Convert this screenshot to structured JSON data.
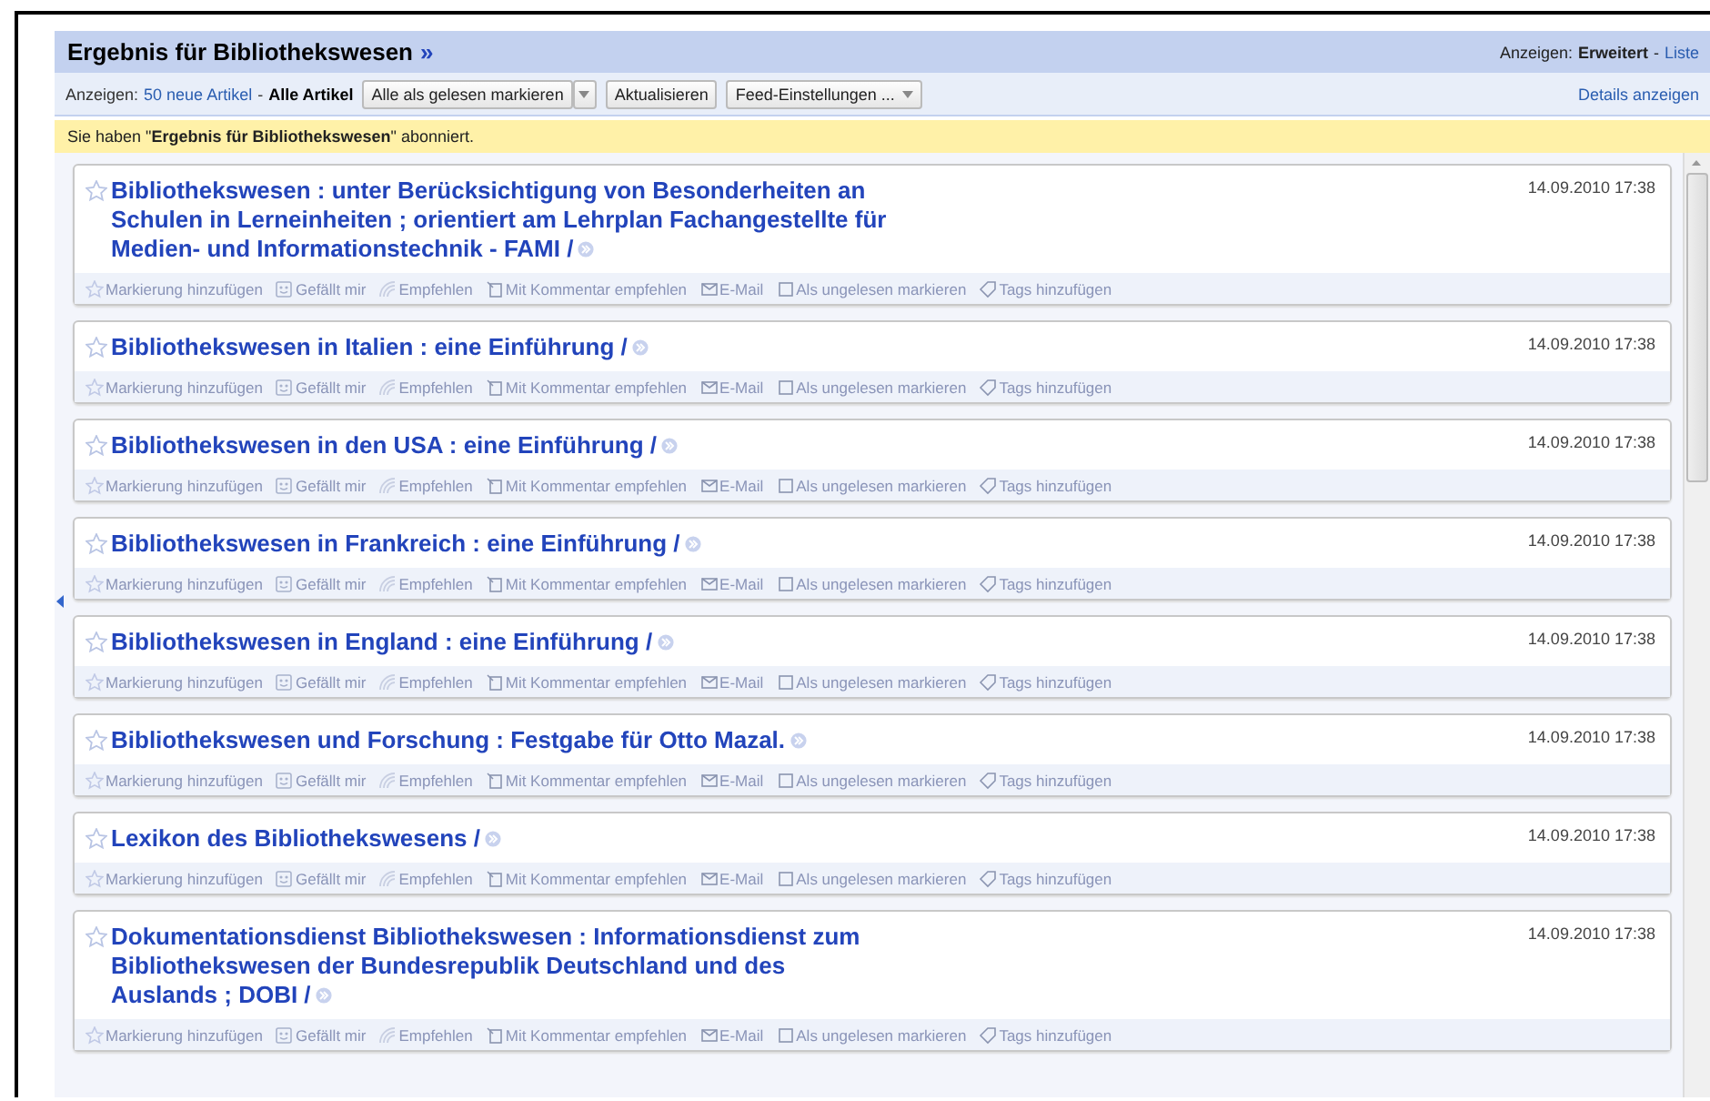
{
  "header": {
    "title": "Ergebnis für Bibliothekswesen",
    "title_link": "»",
    "view_label": "Anzeigen:",
    "view_current": "Erweitert",
    "view_separator": "-",
    "view_other": "Liste"
  },
  "toolbar": {
    "show_label": "Anzeigen:",
    "filters": [
      {
        "label": "50 neue Artikel",
        "selected": false
      },
      {
        "label": "Alle Artikel",
        "selected": true
      }
    ],
    "filter_separator": "-",
    "buttons": [
      {
        "label": "Alle als gelesen markieren",
        "kind": "split"
      },
      {
        "label": "Aktualisieren",
        "kind": "plain"
      },
      {
        "label": "Feed-Einstellungen ...",
        "kind": "dropdown"
      }
    ],
    "details_link": "Details anzeigen"
  },
  "notice": {
    "text": "Sie haben \"**Ergebnis für Bibliothekswesen**\" abonniert."
  },
  "entries": [
    {
      "title": "Bibliothekswesen : unter Berücksichtigung von Besonderheiten an Schulen in Lerneinheiten ; orientiert am Lehrplan Fachangestellte für Medien- und Informationstechnik - FAMI /",
      "date": "14.09.2010 17:38",
      "starred": false,
      "actions": [
        "Markierung hinzufügen",
        "Gefällt mir",
        "Empfehlen",
        "Mit Kommentar empfehlen",
        "E-Mail",
        "Als ungelesen markieren",
        "Tags hinzufügen"
      ]
    },
    {
      "title": "Bibliothekswesen in Italien : eine Einführung /",
      "date": "14.09.2010 17:38",
      "starred": false,
      "actions": [
        "Markierung hinzufügen",
        "Gefällt mir",
        "Empfehlen",
        "Mit Kommentar empfehlen",
        "E-Mail",
        "Als ungelesen markieren",
        "Tags hinzufügen"
      ]
    },
    {
      "title": "Bibliothekswesen in den USA : eine Einführung /",
      "date": "14.09.2010 17:38",
      "starred": false,
      "actions": [
        "Markierung hinzufügen",
        "Gefällt mir",
        "Empfehlen",
        "Mit Kommentar empfehlen",
        "E-Mail",
        "Als ungelesen markieren",
        "Tags hinzufügen"
      ]
    },
    {
      "title": "Bibliothekswesen in Frankreich : eine Einführung /",
      "date": "14.09.2010 17:38",
      "starred": false,
      "actions": [
        "Markierung hinzufügen",
        "Gefällt mir",
        "Empfehlen",
        "Mit Kommentar empfehlen",
        "E-Mail",
        "Als ungelesen markieren",
        "Tags hinzufügen"
      ]
    },
    {
      "title": "Bibliothekswesen in England : eine Einführung /",
      "date": "14.09.2010 17:38",
      "starred": false,
      "actions": [
        "Markierung hinzufügen",
        "Gefällt mir",
        "Empfehlen",
        "Mit Kommentar empfehlen",
        "E-Mail",
        "Als ungelesen markieren",
        "Tags hinzufügen"
      ]
    },
    {
      "title": "Bibliothekswesen und Forschung : Festgabe für Otto Mazal.",
      "date": "14.09.2010 17:38",
      "starred": false,
      "actions": [
        "Markierung hinzufügen",
        "Gefällt mir",
        "Empfehlen",
        "Mit Kommentar empfehlen",
        "E-Mail",
        "Als ungelesen markieren",
        "Tags hinzufügen"
      ]
    },
    {
      "title": "Lexikon des Bibliothekswesens /",
      "date": "14.09.2010 17:38",
      "starred": false,
      "actions": [
        "Markierung hinzufügen",
        "Gefällt mir",
        "Empfehlen",
        "Mit Kommentar empfehlen",
        "E-Mail",
        "Als ungelesen markieren",
        "Tags hinzufügen"
      ]
    },
    {
      "title": "Dokumentationsdienst Bibliothekswesen : Informationsdienst zum Bibliothekswesen der Bundesrepublik Deutschland und des Auslands ; DOBI /",
      "date": "14.09.2010 17:38",
      "starred": false,
      "actions": [
        "Markierung hinzufügen",
        "Gefällt mir",
        "Empfehlen",
        "Mit Kommentar empfehlen",
        "E-Mail",
        "Als ungelesen markieren",
        "Tags hinzufügen"
      ]
    }
  ]
}
